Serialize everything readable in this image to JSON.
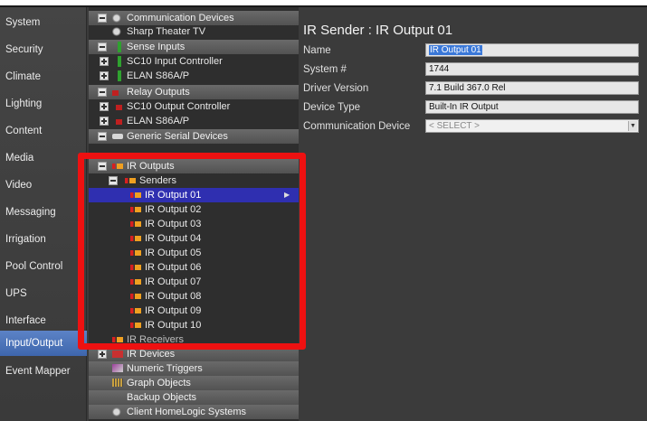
{
  "nav": {
    "items": [
      {
        "label": "System"
      },
      {
        "label": "Security"
      },
      {
        "label": "Climate"
      },
      {
        "label": "Lighting"
      },
      {
        "label": "Content"
      },
      {
        "label": "Media"
      },
      {
        "label": "Video"
      },
      {
        "label": "Messaging"
      },
      {
        "label": "Irrigation"
      },
      {
        "label": "Pool Control"
      },
      {
        "label": "UPS"
      },
      {
        "label": "Interface"
      },
      {
        "label": "Input/Output"
      },
      {
        "label": "Event Mapper"
      }
    ],
    "active": "Input/Output"
  },
  "tree": {
    "rows": [
      {
        "label": "Communication Devices",
        "icon": "comm-icon"
      },
      {
        "label": "Sharp Theater TV",
        "icon": "comm-icon"
      },
      {
        "label": "Sense Inputs",
        "icon": "sense-icon"
      },
      {
        "label": "SC10 Input Controller",
        "icon": "sense-icon"
      },
      {
        "label": "ELAN S86A/P",
        "icon": "sense-icon"
      },
      {
        "label": "Relay Outputs",
        "icon": "relay-icon"
      },
      {
        "label": "SC10 Output Controller",
        "icon": "relay-icon"
      },
      {
        "label": "ELAN S86A/P",
        "icon": "relay-icon"
      },
      {
        "label": "Generic Serial Devices",
        "icon": "serial-icon"
      },
      {
        "label": "IR Outputs",
        "icon": "ir-icon"
      },
      {
        "label": "Senders",
        "icon": "ir-icon"
      },
      {
        "label": "IR Output 01",
        "icon": "ir-icon"
      },
      {
        "label": "IR Output 02",
        "icon": "ir-icon"
      },
      {
        "label": "IR Output 03",
        "icon": "ir-icon"
      },
      {
        "label": "IR Output 04",
        "icon": "ir-icon"
      },
      {
        "label": "IR Output 05",
        "icon": "ir-icon"
      },
      {
        "label": "IR Output 06",
        "icon": "ir-icon"
      },
      {
        "label": "IR Output 07",
        "icon": "ir-icon"
      },
      {
        "label": "IR Output 08",
        "icon": "ir-icon"
      },
      {
        "label": "IR Output 09",
        "icon": "ir-icon"
      },
      {
        "label": "IR Output 10",
        "icon": "ir-icon"
      },
      {
        "label": "IR Receivers",
        "icon": "ir-icon"
      },
      {
        "label": "IR Devices",
        "icon": "ir-device-icon"
      },
      {
        "label": "Numeric Triggers",
        "icon": "numeric-icon"
      },
      {
        "label": "Graph Objects",
        "icon": "graph-icon"
      },
      {
        "label": "Backup Objects",
        "icon": ""
      },
      {
        "label": "Client HomeLogic Systems",
        "icon": "comm-icon"
      }
    ]
  },
  "detail": {
    "title": "IR Sender : IR Output 01",
    "fields": [
      {
        "label": "Name",
        "value": "IR Output 01"
      },
      {
        "label": "System #",
        "value": "1744"
      },
      {
        "label": "Driver Version",
        "value": "7.1 Build 367.0 Rel"
      },
      {
        "label": "Device Type",
        "value": "Built-In IR Output"
      },
      {
        "label": "Communication Device",
        "value": "< SELECT >"
      }
    ]
  },
  "colors": {
    "highlight": "#ee1111",
    "selected_row": "#2f2fb0",
    "active_nav": "#4a72b8"
  }
}
